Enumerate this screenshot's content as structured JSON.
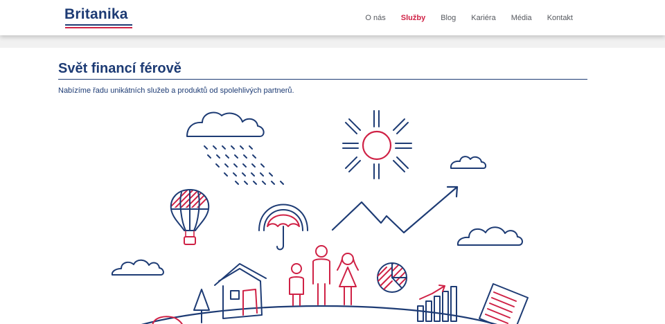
{
  "brand": {
    "name": "Britanika",
    "colors": {
      "navy": "#1d3b74",
      "red": "#cf2145"
    }
  },
  "nav": {
    "items": [
      {
        "label": "O nás",
        "active": false
      },
      {
        "label": "Služby",
        "active": true
      },
      {
        "label": "Blog",
        "active": false
      },
      {
        "label": "Kariéra",
        "active": false
      },
      {
        "label": "Média",
        "active": false
      },
      {
        "label": "Kontakt",
        "active": false
      }
    ]
  },
  "main": {
    "title": "Svět financí férově",
    "subtitle": "Nabízíme řadu unikátních služeb a produktů od spolehlivých partnerů."
  },
  "illustration": {
    "icons": [
      "cloud-icon",
      "rain-icon",
      "sun-icon",
      "hot-air-balloon-icon",
      "umbrella-icon",
      "growth-arrow-icon",
      "family-icon",
      "house-icon",
      "pie-chart-icon",
      "bar-chart-icon",
      "document-icon",
      "tree-icon"
    ]
  }
}
